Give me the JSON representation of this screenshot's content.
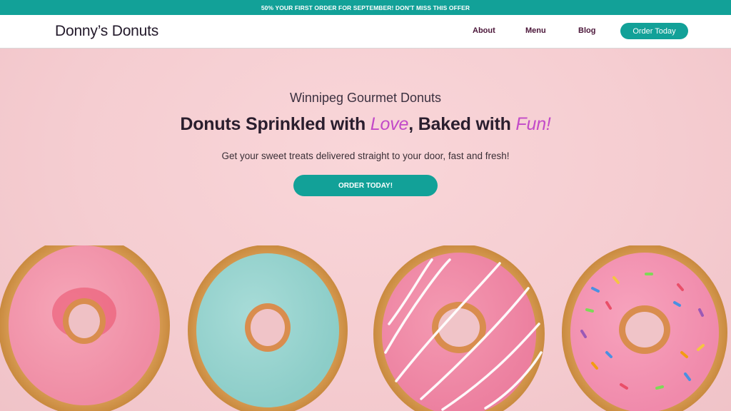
{
  "promo": {
    "text": "50% YOUR FIRST ORDER FOR SEPTEMBER! DON'T MISS THIS OFFER"
  },
  "header": {
    "brand": "Donny’s Donuts",
    "nav": {
      "about": "About",
      "menu": "Menu",
      "blog": "Blog"
    },
    "cta": "Order Today"
  },
  "hero": {
    "eyebrow": "Winnipeg Gourmet Donuts",
    "headline": {
      "part1": "Donuts Sprinkled with ",
      "accent1": "Love",
      "part2": ", Baked with ",
      "accent2": "Fun!"
    },
    "subhead": "Get your sweet treats delivered straight to your door, fast and fresh!",
    "cta": "ORDER TODAY!"
  },
  "colors": {
    "teal": "#12a198",
    "accent_pink": "#c24ac8",
    "hero_bg": "#f6cfd2"
  }
}
